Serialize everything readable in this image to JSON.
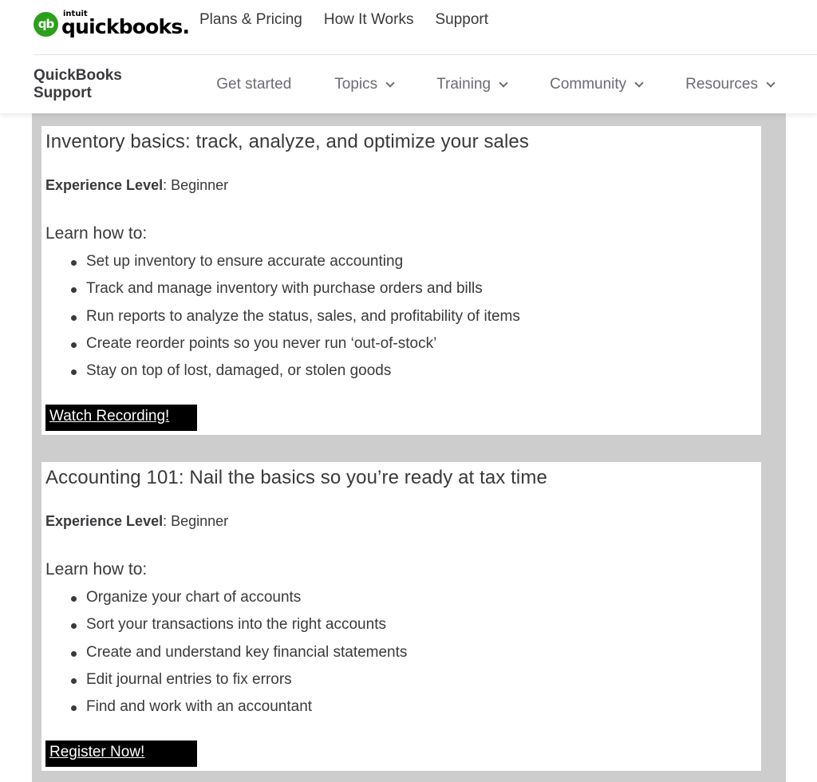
{
  "brand": {
    "logo_mark": "qb",
    "logo_small": "intuit",
    "logo_name": "quickbooks",
    "logo_suffix": ".",
    "color": "#2ca01c"
  },
  "top_nav": [
    {
      "label": "Plans & Pricing"
    },
    {
      "label": "How It Works"
    },
    {
      "label": "Support"
    }
  ],
  "sub_nav": {
    "title": "QuickBooks Support",
    "items": [
      {
        "label": "Get started",
        "dropdown": false
      },
      {
        "label": "Topics",
        "dropdown": true
      },
      {
        "label": "Training",
        "dropdown": true
      },
      {
        "label": "Community",
        "dropdown": true
      },
      {
        "label": "Resources",
        "dropdown": true
      }
    ]
  },
  "courses": [
    {
      "title": "Inventory basics: track, analyze, and optimize your sales",
      "experience_label": "Experience Level",
      "experience_value": ": Beginner",
      "learn_heading": "Learn how to:",
      "items": [
        "Set up inventory to ensure accurate accounting",
        "Track and manage inventory with purchase orders and bills",
        "Run reports to analyze the status, sales, and profitability of items",
        "Create reorder points so you never run ‘out-of-stock’",
        "Stay on top of lost, damaged, or stolen goods"
      ],
      "cta": "Watch Recording!"
    },
    {
      "title": "Accounting 101: Nail the basics so you’re ready at tax time",
      "experience_label": "Experience Level",
      "experience_value": ": Beginner",
      "learn_heading": "Learn how to:",
      "items": [
        "Organize your chart of accounts",
        "Sort your transactions into the right accounts",
        "Create and understand key financial statements",
        "Edit journal entries to fix errors",
        "Find and work with an accountant"
      ],
      "cta": "Register Now!"
    }
  ]
}
